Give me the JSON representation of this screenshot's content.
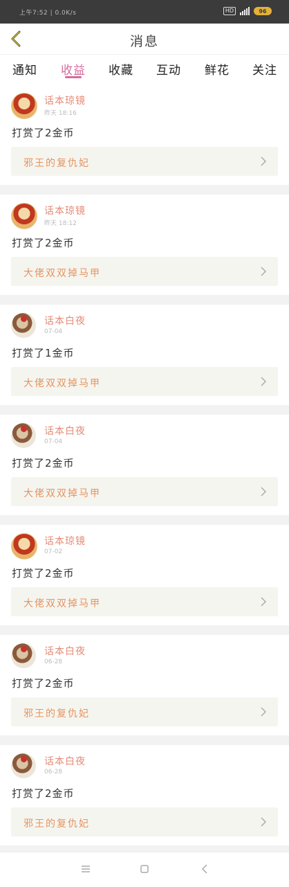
{
  "status": {
    "time": "上午7:52 | 0.0K/s",
    "hd": "HD",
    "battery": "96"
  },
  "header": {
    "title": "消息"
  },
  "tabs": [
    {
      "label": "通知"
    },
    {
      "label": "收益"
    },
    {
      "label": "收藏"
    },
    {
      "label": "互动"
    },
    {
      "label": "鲜花"
    },
    {
      "label": "关注"
    }
  ],
  "items": [
    {
      "name": "话本琼镜",
      "time": "昨天 18:16",
      "desc": "打赏了2金币",
      "book": "邪王的复仇妃"
    },
    {
      "name": "话本琼镜",
      "time": "昨天 18:12",
      "desc": "打赏了2金币",
      "book": "大佬双双掉马甲"
    },
    {
      "name": "话本白夜",
      "time": "07-04",
      "desc": "打赏了1金币",
      "book": "大佬双双掉马甲"
    },
    {
      "name": "话本白夜",
      "time": "07-04",
      "desc": "打赏了2金币",
      "book": "大佬双双掉马甲"
    },
    {
      "name": "话本琼镜",
      "time": "07-02",
      "desc": "打赏了2金币",
      "book": "大佬双双掉马甲"
    },
    {
      "name": "话本白夜",
      "time": "06-28",
      "desc": "打赏了2金币",
      "book": "邪王的复仇妃"
    },
    {
      "name": "话本白夜",
      "time": "06-28",
      "desc": "打赏了2金币",
      "book": "邪王的复仇妃"
    }
  ],
  "colors": {
    "accent": "#d46c9c",
    "name": "#e58a76",
    "book": "#e5935f"
  }
}
